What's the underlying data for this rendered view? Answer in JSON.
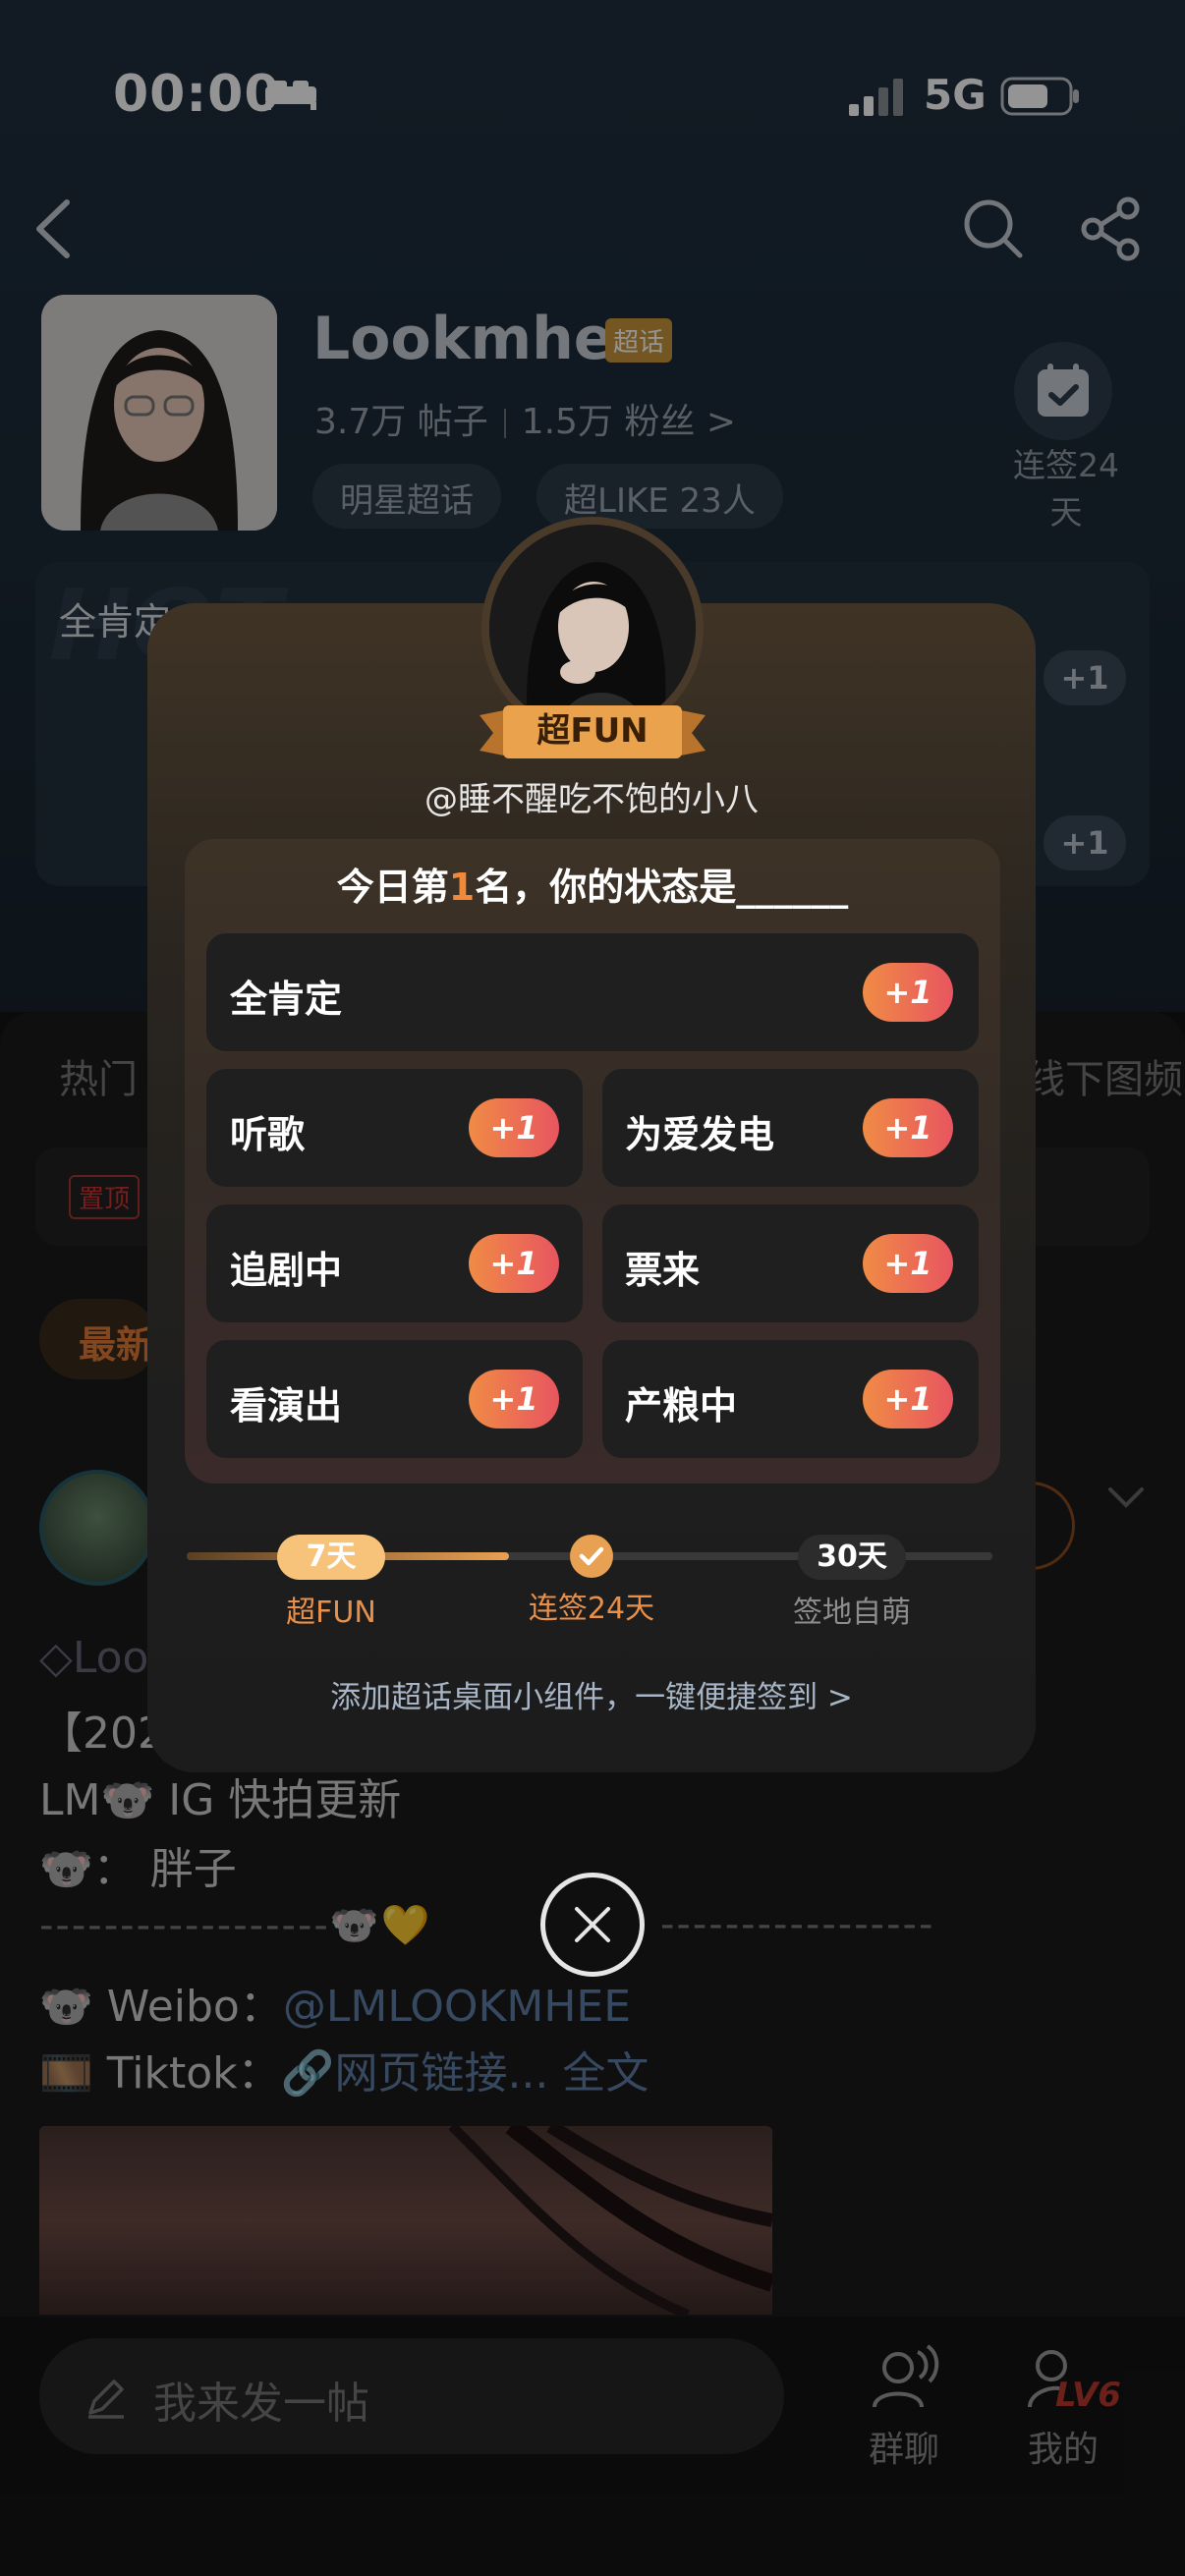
{
  "status_bar": {
    "time": "00:00",
    "network": "5G"
  },
  "profile": {
    "name": "Lookmhee",
    "badge": "超话",
    "posts_count": "3.7万 帖子",
    "fans_count": "1.5万 粉丝",
    "fans_chevron": ">",
    "chip_star": "明星超话",
    "chip_like": "超LIKE 23人",
    "signin_label": "连签24天"
  },
  "cards": {
    "watermark": "HOT",
    "first_label": "全肯定",
    "plus_labels": [
      "+1",
      "+1"
    ]
  },
  "tabs": {
    "first": "热门",
    "right": "线下图频"
  },
  "pinned": {
    "tag": "置顶"
  },
  "latest_chip": "最新",
  "post": {
    "line_1": "Loo",
    "line_2": "【2020",
    "line_3": "LM🐨 IG 快拍更新",
    "line_4": "🐨： 胖子",
    "dash_left": "------------------🐨💛",
    "dash_right": "-----------------",
    "weibo_label": "🐨 Weibo：",
    "weibo_link": "@LMLOOKMHEE",
    "tiktok_label": "🎞️ Tiktok：",
    "tiktok_link": "🔗网页链接...",
    "full_text": " 全文"
  },
  "bottom_bar": {
    "compose_placeholder": "我来发一帖",
    "group_chat": "群聊",
    "mine": "我的",
    "level": "LV6"
  },
  "modal": {
    "rank_badge": "超FUN",
    "username": "@睡不醒吃不饱的小八",
    "rank_prefix": "今日第",
    "rank_number": "1",
    "rank_suffix": "名，你的状态是______",
    "options": [
      {
        "label": "全肯定",
        "plus": "+1"
      },
      {
        "label": "听歌",
        "plus": "+1"
      },
      {
        "label": "为爱发电",
        "plus": "+1"
      },
      {
        "label": "追剧中",
        "plus": "+1"
      },
      {
        "label": "票来",
        "plus": "+1"
      },
      {
        "label": "看演出",
        "plus": "+1"
      },
      {
        "label": "产粮中",
        "plus": "+1"
      }
    ],
    "progress": {
      "current_streak_days": 24,
      "max_days": 30,
      "milestones": [
        {
          "chip": "7天",
          "label": "超FUN"
        },
        {
          "chip": "",
          "label": "连签24天"
        },
        {
          "chip": "30天",
          "label": "签地自萌"
        }
      ]
    },
    "widget_link": "添加超话桌面小组件，一键便捷签到 >"
  },
  "colors": {
    "accent_orange": "#f08a3a",
    "plus_gradient_start": "#f08b45",
    "plus_gradient_end": "#e85560",
    "link_blue": "#5f7fa8"
  }
}
